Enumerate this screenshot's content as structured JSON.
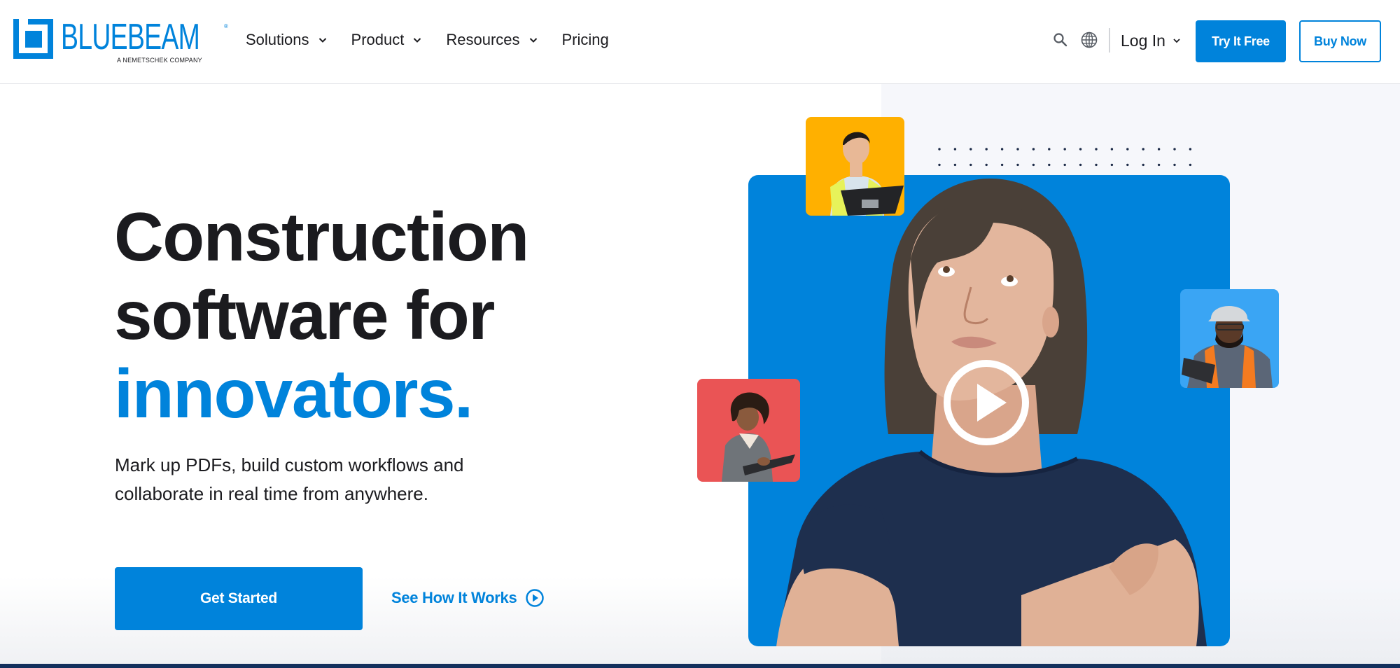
{
  "brand": {
    "name": "BLUEBEAM",
    "registered_mark": "®",
    "tagline": "A NEMETSCHEK COMPANY",
    "colors": {
      "primary": "#0083db",
      "text": "#1b1b1f",
      "accent_yellow": "#ffb000",
      "accent_red": "#ea5455",
      "accent_light_blue": "#3aa5f4",
      "navy": "#13305d"
    }
  },
  "nav": {
    "items": [
      {
        "label": "Solutions",
        "has_dropdown": true
      },
      {
        "label": "Product",
        "has_dropdown": true
      },
      {
        "label": "Resources",
        "has_dropdown": true
      },
      {
        "label": "Pricing",
        "has_dropdown": false
      }
    ],
    "icons": {
      "search": "search-icon",
      "language": "globe-icon"
    },
    "login_label": "Log In",
    "try_free_label": "Try It Free",
    "buy_now_label": "Buy Now"
  },
  "hero": {
    "headline_line1": "Construction",
    "headline_line2": "software for",
    "headline_line3": "innovators.",
    "subcopy": "Mark up PDFs, build custom workflows and collaborate in real time from anywhere.",
    "primary_cta": "Get Started",
    "secondary_cta": "See How It Works",
    "video": {
      "play_icon": "play-icon"
    }
  }
}
